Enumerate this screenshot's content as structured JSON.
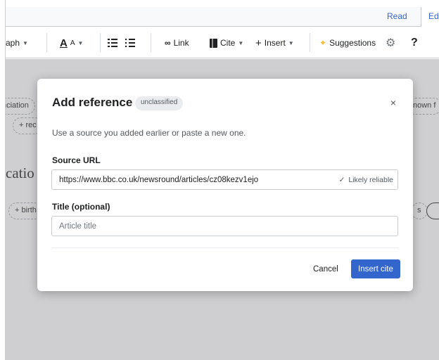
{
  "tabs": {
    "read": "Read",
    "edit": "Ed"
  },
  "toolbar": {
    "paragraph": "aph",
    "text_style": "A",
    "link": "Link",
    "cite": "Cite",
    "insert": "Insert",
    "suggestions": "Suggestions",
    "help": "?"
  },
  "background": {
    "pill_pronunciation": "nciation",
    "pill_rec": "+ rec",
    "pill_known": "nown f",
    "heading_fragment": "catio",
    "pill_birth": "+ birth",
    "pill_right_s": "s"
  },
  "dialog": {
    "title": "Add reference",
    "badge": "unclassified",
    "close": "×",
    "intro": "Use a source you added earlier or paste a new one.",
    "source_label": "Source URL",
    "source_value": "https://www.bbc.co.uk/newsround/articles/cz08kezv1ejo",
    "reliability_check": "✓",
    "reliability": "Likely reliable",
    "title_label": "Title (optional)",
    "title_placeholder": "Article title",
    "cancel": "Cancel",
    "insert": "Insert cite"
  },
  "colors": {
    "accent": "#3366cc",
    "overlay": "#808286"
  }
}
